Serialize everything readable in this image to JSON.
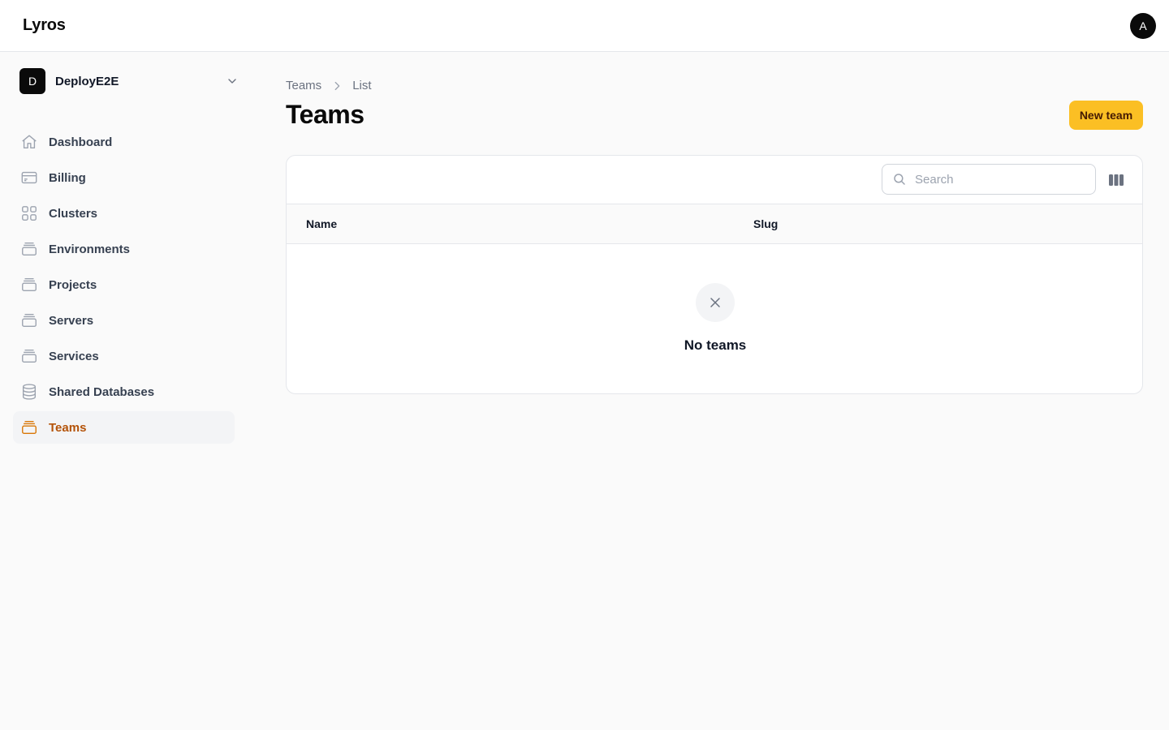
{
  "app": {
    "brand": "Lyros",
    "avatar_initial": "A"
  },
  "tenant": {
    "initial": "D",
    "name": "DeployE2E"
  },
  "sidebar": {
    "items": [
      {
        "label": "Dashboard",
        "icon": "home-icon",
        "active": false
      },
      {
        "label": "Billing",
        "icon": "credit-card-icon",
        "active": false
      },
      {
        "label": "Clusters",
        "icon": "grid-icon",
        "active": false
      },
      {
        "label": "Environments",
        "icon": "stack-icon",
        "active": false
      },
      {
        "label": "Projects",
        "icon": "stack-icon",
        "active": false
      },
      {
        "label": "Servers",
        "icon": "stack-icon",
        "active": false
      },
      {
        "label": "Services",
        "icon": "stack-icon",
        "active": false
      },
      {
        "label": "Shared Databases",
        "icon": "database-icon",
        "active": false
      },
      {
        "label": "Teams",
        "icon": "stack-icon",
        "active": true
      }
    ]
  },
  "breadcrumb": {
    "items": [
      "Teams",
      "List"
    ]
  },
  "page": {
    "title": "Teams",
    "new_button": "New team"
  },
  "table": {
    "search_placeholder": "Search",
    "columns": [
      "Name",
      "Slug"
    ],
    "rows": [],
    "empty_text": "No teams"
  },
  "colors": {
    "accent": "#fbbf24",
    "active_text": "#b45309",
    "brand_dark": "#0a0a0a"
  }
}
